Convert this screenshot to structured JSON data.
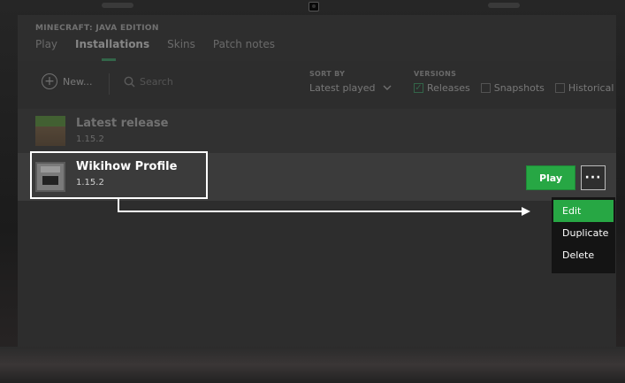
{
  "app": {
    "edition": "MINECRAFT: JAVA EDITION"
  },
  "tabs": [
    {
      "label": "Play"
    },
    {
      "label": "Installations",
      "active": true
    },
    {
      "label": "Skins"
    },
    {
      "label": "Patch notes"
    }
  ],
  "toolbar": {
    "new_label": "New...",
    "search_placeholder": "Search",
    "sort_label": "SORT BY",
    "sort_value": "Latest played",
    "versions_label": "VERSIONS",
    "versions": [
      {
        "label": "Releases",
        "checked": true
      },
      {
        "label": "Snapshots",
        "checked": false
      },
      {
        "label": "Historical",
        "checked": false
      }
    ]
  },
  "installations": [
    {
      "name": "Latest release",
      "version": "1.15.2"
    },
    {
      "name": "Wikihow Profile",
      "version": "1.15.2"
    }
  ],
  "actions": {
    "play_label": "Play",
    "more_label": "···"
  },
  "menu": {
    "items": [
      "Edit",
      "Duplicate",
      "Delete"
    ]
  },
  "colors": {
    "accent": "#27a744",
    "background": "#2d2d2d"
  }
}
